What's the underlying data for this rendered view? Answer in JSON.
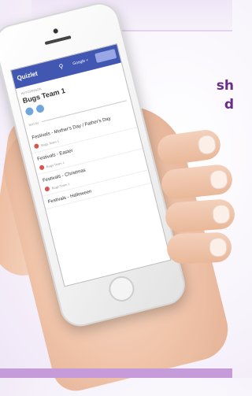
{
  "side_text": {
    "line1": "sh",
    "line2": "d"
  },
  "app": {
    "logo": "Quizlet",
    "nav_google": "Google +",
    "nav_signup": "",
    "breadcrumb": "HUTCHINSON",
    "title": "Bugs Team 1",
    "filter_label": "Sort by"
  },
  "sets": [
    {
      "title": "Festivals - Mother's Day / Father's Day",
      "author": "Bugs Team 1"
    },
    {
      "title": "Festivals - Easter",
      "author": "Bugs Team 1"
    },
    {
      "title": "Festivals - Christmas",
      "author": "Bugs Team 1"
    },
    {
      "title": "Festivals - Halloween",
      "author": ""
    }
  ],
  "colors": {
    "brand": "#4257b2",
    "accent_text": "#6a2c86",
    "band": "#c59bd9"
  }
}
